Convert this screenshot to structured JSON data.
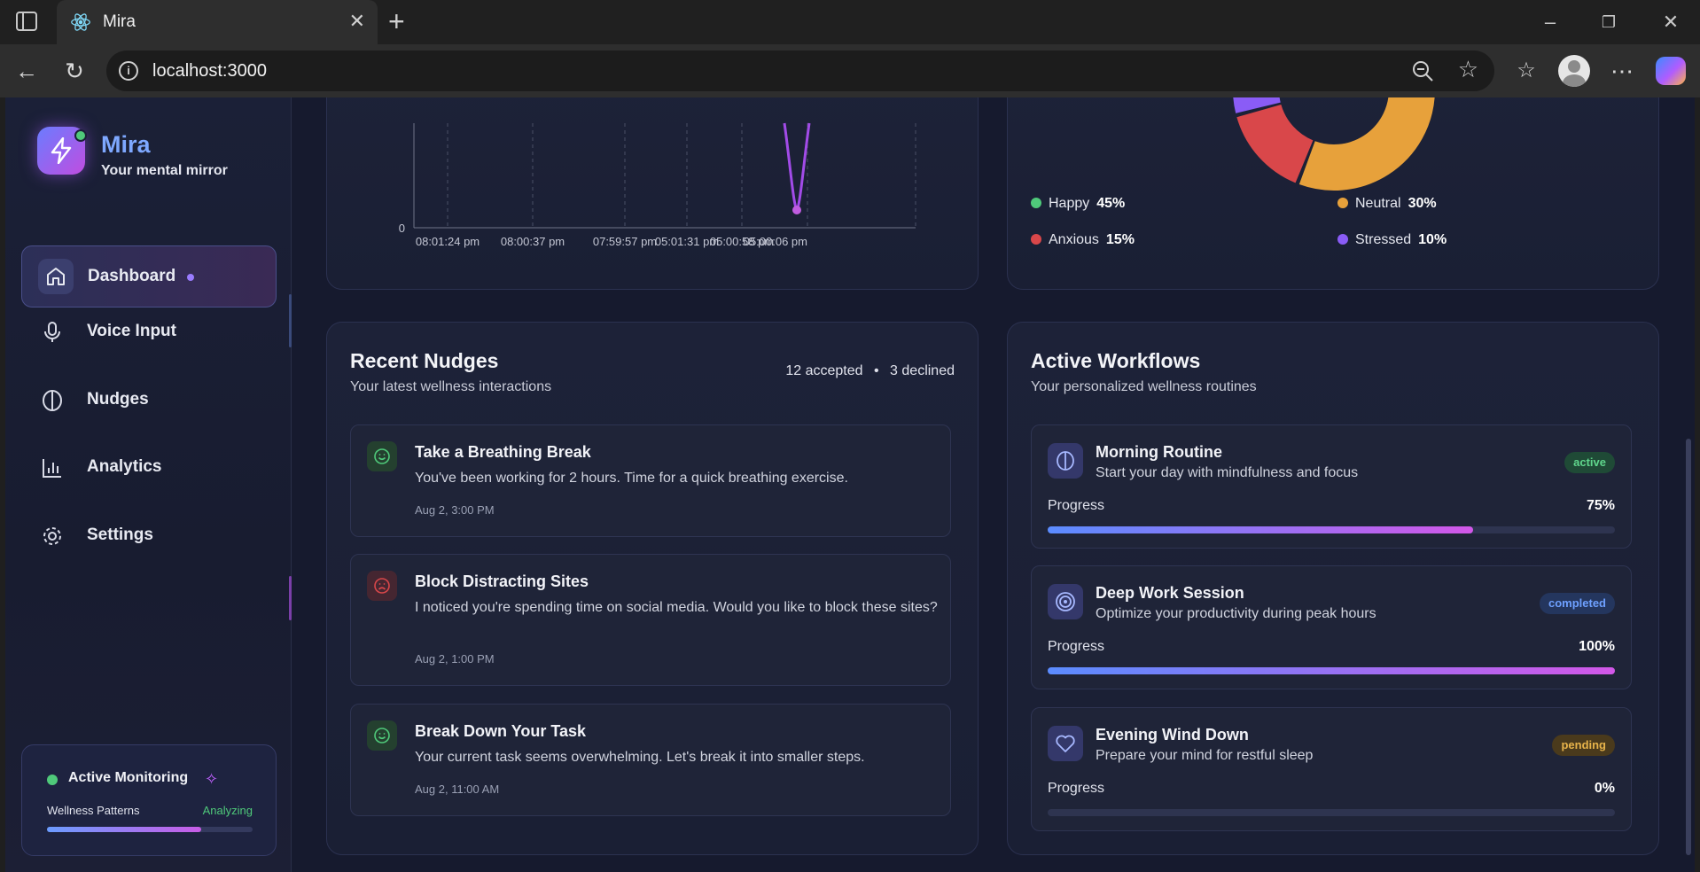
{
  "browser": {
    "tab_title": "Mira",
    "url": "localhost:3000"
  },
  "sidebar": {
    "brand_name": "Mira",
    "brand_tagline": "Your mental mirror",
    "items": [
      {
        "label": "Dashboard",
        "icon": "home-icon",
        "active": true
      },
      {
        "label": "Voice Input",
        "icon": "mic-icon"
      },
      {
        "label": "Nudges",
        "icon": "brain-icon"
      },
      {
        "label": "Analytics",
        "icon": "bar-chart-icon"
      },
      {
        "label": "Settings",
        "icon": "gear-icon"
      }
    ],
    "monitoring": {
      "title": "Active Monitoring",
      "label": "Wellness Patterns",
      "status": "Analyzing",
      "progress": 0.75
    }
  },
  "trend_chart": {
    "y_tick": "0",
    "x_ticks": [
      "08:01:24 pm",
      "08:00:37 pm",
      "07:59:57 pm",
      "05:01:31 pm",
      "05:00:58 pm",
      "05:00:06 pm"
    ]
  },
  "mood_chart": {
    "legend": [
      {
        "label": "Happy",
        "value": "45%",
        "color": "#4fc97a"
      },
      {
        "label": "Neutral",
        "value": "30%",
        "color": "#e7a13b"
      },
      {
        "label": "Anxious",
        "value": "15%",
        "color": "#d9474a"
      },
      {
        "label": "Stressed",
        "value": "10%",
        "color": "#8a5cf6"
      }
    ]
  },
  "chart_data": {
    "type": "pie",
    "categories": [
      "Happy",
      "Neutral",
      "Anxious",
      "Stressed"
    ],
    "values": [
      45,
      30,
      15,
      10
    ]
  },
  "nudges": {
    "title": "Recent Nudges",
    "subtitle": "Your latest wellness interactions",
    "accepted": "12 accepted",
    "declined": "3 declined",
    "items": [
      {
        "title": "Take a Breathing Break",
        "body": "You've been working for 2 hours. Time for a quick breathing exercise.",
        "time": "Aug 2, 3:00 PM",
        "icon": "smile-icon"
      },
      {
        "title": "Block Distracting Sites",
        "body": "I noticed you're spending time on social media. Would you like to block these sites?",
        "time": "Aug 2, 1:00 PM",
        "icon": "frown-icon"
      },
      {
        "title": "Break Down Your Task",
        "body": "Your current task seems overwhelming. Let's break it into smaller steps.",
        "time": "Aug 2, 11:00 AM",
        "icon": "smile-icon"
      }
    ]
  },
  "workflows": {
    "title": "Active Workflows",
    "subtitle": "Your personalized wellness routines",
    "progress_label": "Progress",
    "items": [
      {
        "title": "Morning Routine",
        "desc": "Start your day with mindfulness and focus",
        "status": "active",
        "progress": "75%",
        "fill": 0.75,
        "icon": "brain-icon"
      },
      {
        "title": "Deep Work Session",
        "desc": "Optimize your productivity during peak hours",
        "status": "completed",
        "progress": "100%",
        "fill": 1.0,
        "icon": "target-icon"
      },
      {
        "title": "Evening Wind Down",
        "desc": "Prepare your mind for restful sleep",
        "status": "pending",
        "progress": "0%",
        "fill": 0,
        "icon": "heart-icon"
      }
    ]
  }
}
